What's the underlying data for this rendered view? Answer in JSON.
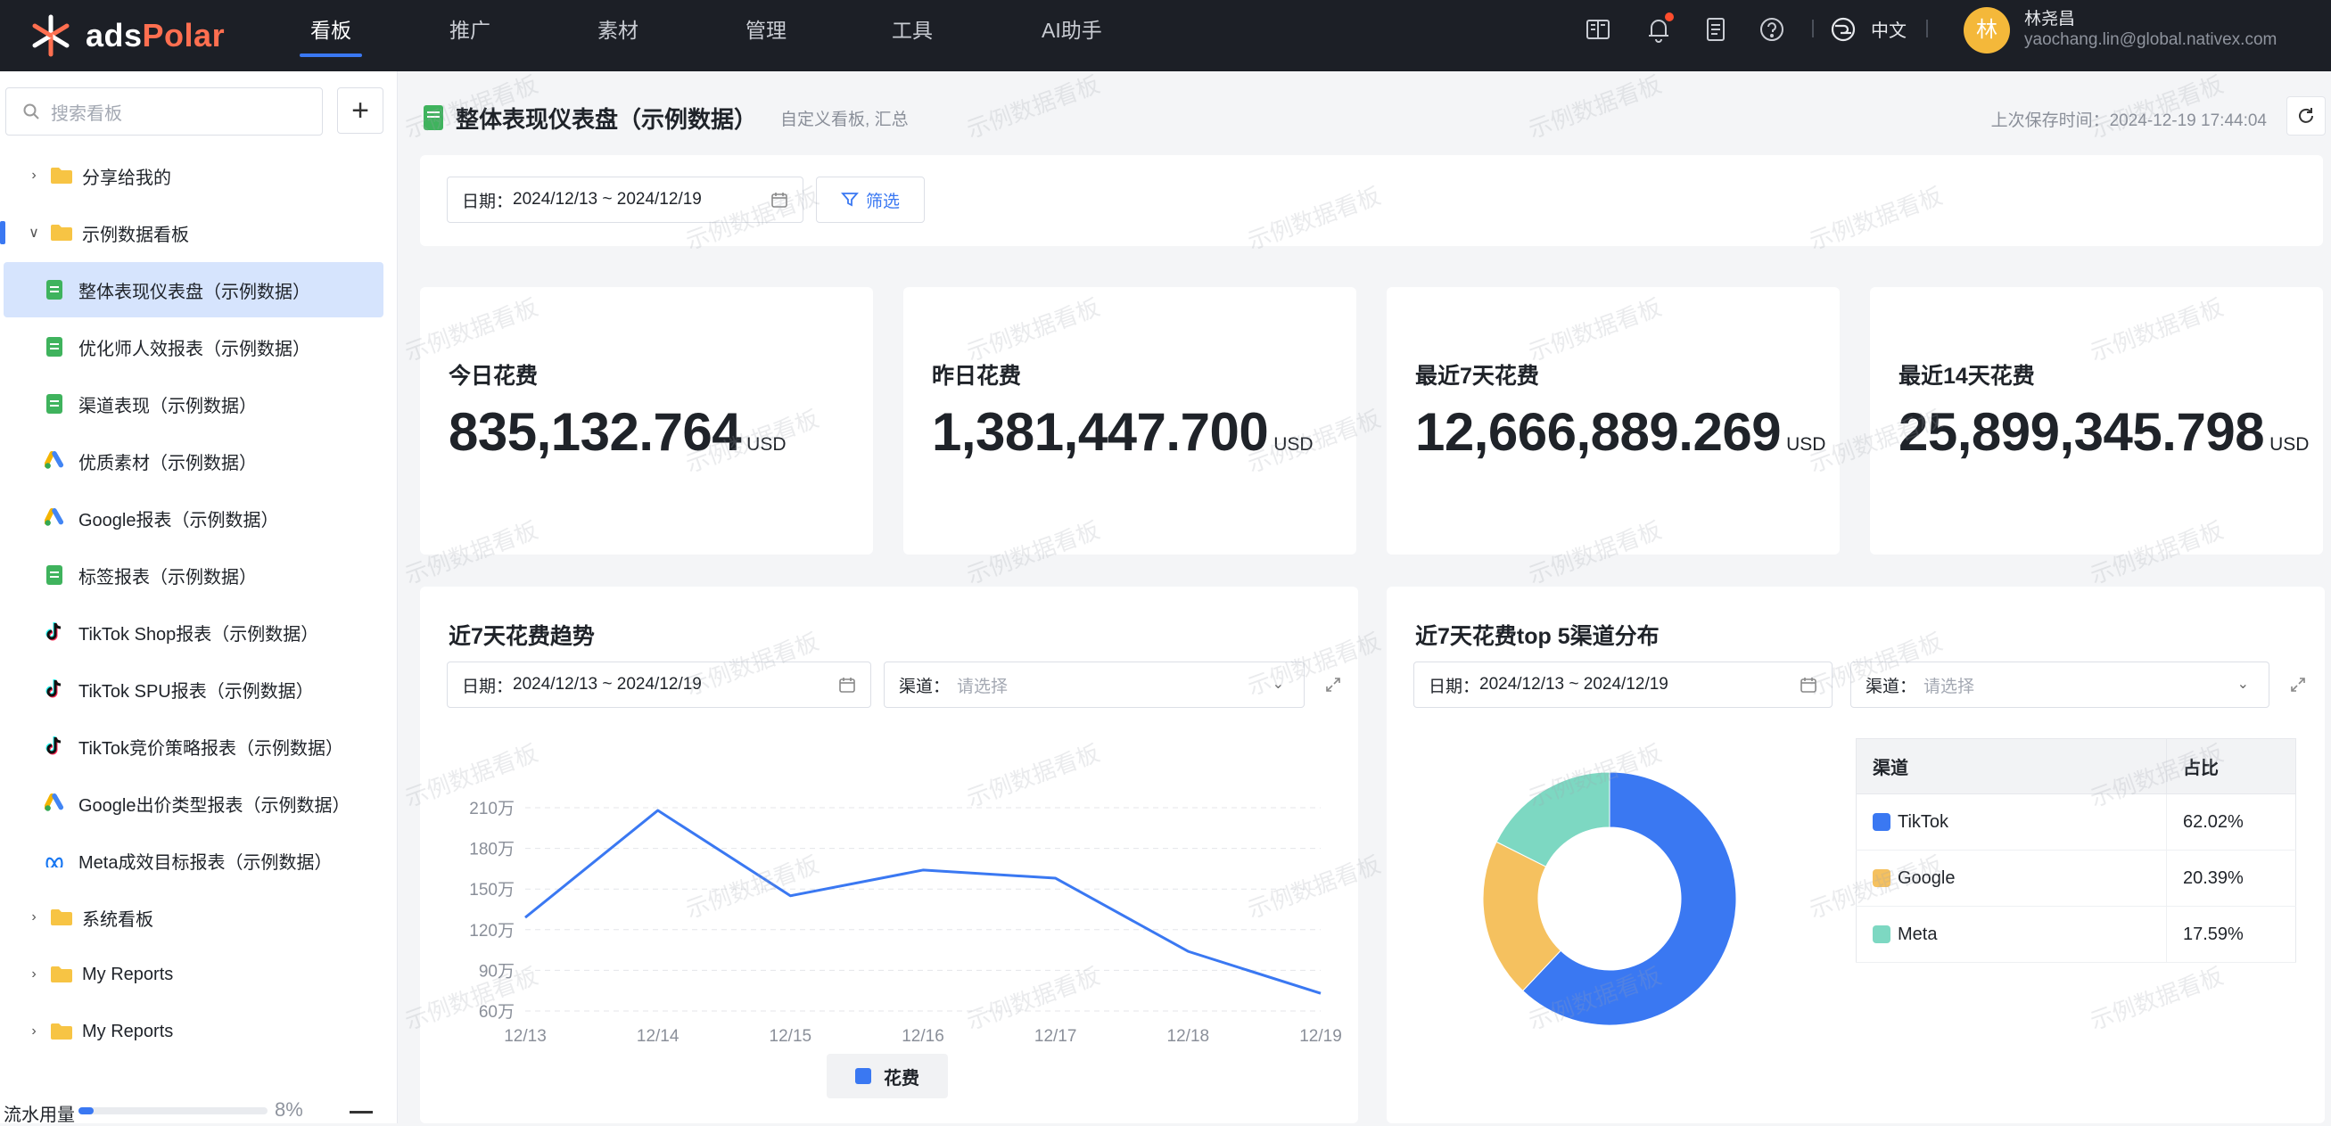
{
  "app": {
    "logo_a": "ads",
    "logo_b": "Polar",
    "nav": [
      "看板",
      "推广",
      "素材",
      "管理",
      "工具",
      "AI助手"
    ],
    "active_nav": 0,
    "language": "中文",
    "user": {
      "initial": "林",
      "name": "林尧昌",
      "email": "yaochang.lin@global.nativex.com"
    }
  },
  "sidebar": {
    "search_placeholder": "搜索看板",
    "add_label": "+",
    "items": [
      {
        "label": "分享给我的",
        "type": "folder",
        "expanded": false
      },
      {
        "label": "示例数据看板",
        "type": "folder",
        "expanded": true
      },
      {
        "label": "整体表现仪表盘（示例数据）",
        "type": "doc",
        "icon": "doc-icon",
        "selected": true
      },
      {
        "label": "优化师人效报表（示例数据）",
        "type": "doc",
        "icon": "doc-icon"
      },
      {
        "label": "渠道表现（示例数据）",
        "type": "doc",
        "icon": "doc-icon"
      },
      {
        "label": "优质素材（示例数据）",
        "type": "doc",
        "icon": "google-ads-icon"
      },
      {
        "label": "Google报表（示例数据）",
        "type": "doc",
        "icon": "google-ads-icon"
      },
      {
        "label": "标签报表（示例数据）",
        "type": "doc",
        "icon": "doc-icon"
      },
      {
        "label": "TikTok Shop报表（示例数据）",
        "type": "doc",
        "icon": "tiktok-icon"
      },
      {
        "label": "TikTok SPU报表（示例数据）",
        "type": "doc",
        "icon": "tiktok-icon"
      },
      {
        "label": "TikTok竞价策略报表（示例数据）",
        "type": "doc",
        "icon": "tiktok-icon"
      },
      {
        "label": "Google出价类型报表（示例数据）",
        "type": "doc",
        "icon": "google-ads-icon"
      },
      {
        "label": "Meta成效目标报表（示例数据）",
        "type": "doc",
        "icon": "meta-icon"
      },
      {
        "label": "系统看板",
        "type": "folder",
        "expanded": false
      },
      {
        "label": "My Reports",
        "type": "folder",
        "expanded": false
      },
      {
        "label": "My Reports",
        "type": "folder",
        "expanded": false
      }
    ],
    "usage_label": "流水用量",
    "usage_percent": 8,
    "usage_text": "8%"
  },
  "dashboard": {
    "title": "整体表现仪表盘（示例数据）",
    "subtitle": "自定义看板, 汇总",
    "save_time": "上次保存时间：2024-12-19 17:44:04",
    "date_prefix": "日期：",
    "date_range": "2024/12/13 ~ 2024/12/19",
    "filter_label": "筛选",
    "watermark": "示例数据看板",
    "kpis": [
      {
        "label": "今日花费",
        "value": "835,132.764",
        "unit": "USD"
      },
      {
        "label": "昨日花费",
        "value": "1,381,447.700",
        "unit": "USD"
      },
      {
        "label": "最近7天花费",
        "value": "12,666,889.269",
        "unit": "USD"
      },
      {
        "label": "最近14天花费",
        "value": "25,899,345.798",
        "unit": "USD"
      }
    ],
    "channel_prefix": "渠道：",
    "channel_placeholder": "请选择"
  },
  "chart_data": [
    {
      "type": "line",
      "title": "近7天花费趋势",
      "x": [
        "12/13",
        "12/14",
        "12/15",
        "12/16",
        "12/17",
        "12/18",
        "12/19"
      ],
      "series": [
        {
          "name": "花费",
          "values": [
            1290000,
            2080000,
            1450000,
            1640000,
            1580000,
            1040000,
            730000
          ]
        }
      ],
      "yticks": [
        "60万",
        "90万",
        "120万",
        "150万",
        "180万",
        "210万"
      ],
      "ylim": [
        600000,
        2100000
      ],
      "color": "#3a78f2",
      "grid": true,
      "legend": "bottom"
    },
    {
      "type": "pie",
      "title": "近7天花费top 5渠道分布",
      "table_headers": [
        "渠道",
        "占比"
      ],
      "categories": [
        "TikTok",
        "Google",
        "Meta"
      ],
      "values": [
        62.02,
        20.39,
        17.59
      ],
      "labels": [
        "62.02%",
        "20.39%",
        "17.59%"
      ],
      "colors": [
        "#3a78f2",
        "#f5c15f",
        "#7dd8c2"
      ],
      "legend": "right-table"
    }
  ]
}
